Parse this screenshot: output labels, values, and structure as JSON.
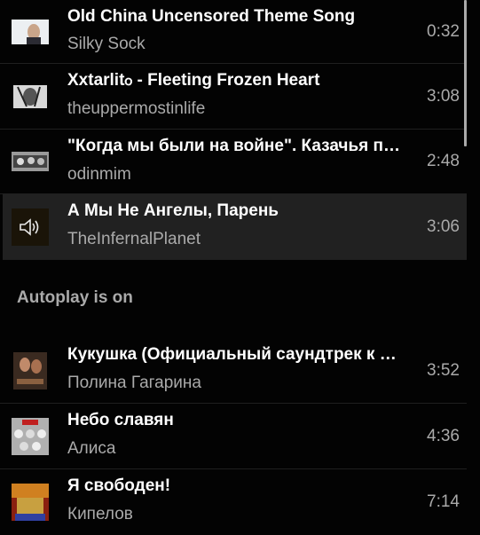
{
  "queue": [
    {
      "title": "Old China Uncensored Theme Song",
      "artist": "Silky Sock",
      "duration": "0:32"
    },
    {
      "title": "Xxtarlitჿ - Fleeting Frozen Heart",
      "artist": "theuppermostinlife",
      "duration": "3:08"
    },
    {
      "title": "\"Когда мы были на войне\". Казачья песня",
      "artist": "odinmim",
      "duration": "2:48"
    },
    {
      "title": "А Мы Не Ангелы, Парень",
      "artist": "TheInfernalPlanet",
      "duration": "3:06",
      "now_playing": true
    }
  ],
  "autoplay": {
    "label": "Autoplay is on"
  },
  "autoplay_items": [
    {
      "title": "Кукушка (Официальный саундтрек к фильму)",
      "artist": "Полина Гагарина",
      "duration": "3:52"
    },
    {
      "title": "Небо славян",
      "artist": "Алиса",
      "duration": "4:36"
    },
    {
      "title": "Я свободен!",
      "artist": "Кипелов",
      "duration": "7:14"
    }
  ],
  "colors": {
    "background": "#030303",
    "playing_row": "#212121",
    "secondary_text": "#aaaaaa"
  },
  "icons": {
    "now_playing": "speaker-icon"
  }
}
